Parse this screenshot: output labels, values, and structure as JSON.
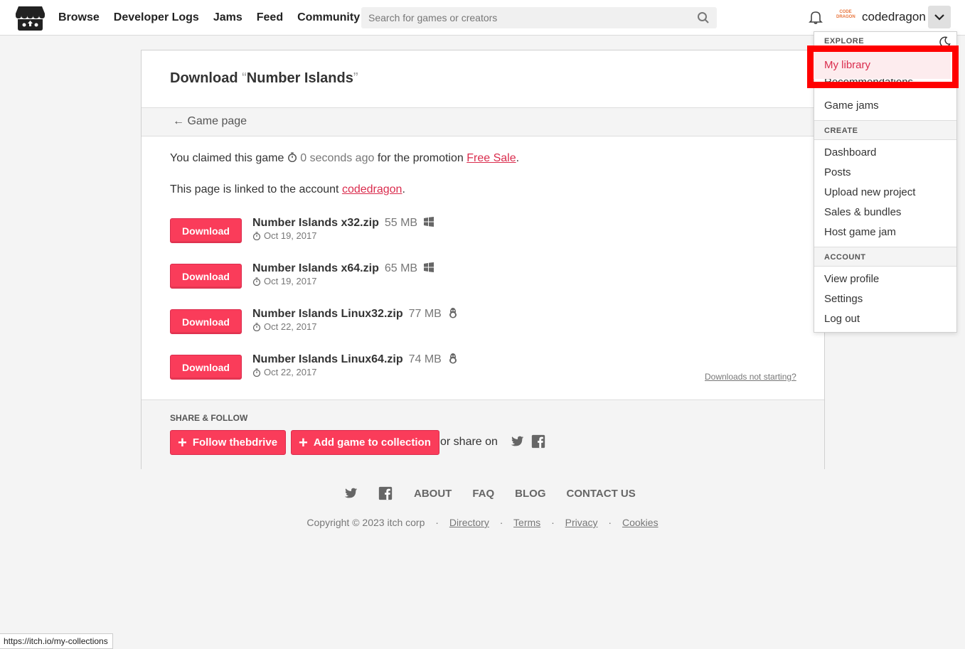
{
  "header": {
    "nav": [
      "Browse",
      "Developer Logs",
      "Jams",
      "Feed",
      "Community"
    ],
    "search_placeholder": "Search for games or creators",
    "username": "codedragon",
    "avatar_text": "CODE DRAGON"
  },
  "page": {
    "title_prefix": "Download ",
    "title_open_quote": "“",
    "title_game": "Number Islands",
    "title_close_quote": "”",
    "back_link": "← Game page",
    "claim_text_1": "You claimed this game",
    "claim_time": "0 seconds ago",
    "claim_text_2": "for the promotion",
    "promotion": "Free Sale",
    "linked_text": "This page is linked to the account",
    "linked_account": "codedragon",
    "download_label": "Download",
    "downloads_not_starting": "Downloads not starting?",
    "uploads": [
      {
        "name": "Number Islands x32.zip",
        "size": "55 MB",
        "platform": "windows-icon",
        "date": "Oct 19, 2017"
      },
      {
        "name": "Number Islands x64.zip",
        "size": "65 MB",
        "platform": "windows-icon",
        "date": "Oct 19, 2017"
      },
      {
        "name": "Number Islands Linux32.zip",
        "size": "77 MB",
        "platform": "linux-icon",
        "date": "Oct 22, 2017"
      },
      {
        "name": "Number Islands Linux64.zip",
        "size": "74 MB",
        "platform": "linux-icon",
        "date": "Oct 22, 2017"
      }
    ]
  },
  "share": {
    "title": "SHARE & FOLLOW",
    "follow_label": "Follow thebdrive",
    "collection_label": "Add game to collection",
    "share_on": "or share on"
  },
  "footer": {
    "links": [
      "ABOUT",
      "FAQ",
      "BLOG",
      "CONTACT US"
    ],
    "copyright": "Copyright © 2023 itch corp",
    "legal": [
      "Directory",
      "Terms",
      "Privacy",
      "Cookies"
    ],
    "separator": "·"
  },
  "dropdown": {
    "sections": [
      {
        "title": "EXPLORE",
        "items": [
          "My library",
          "Recommendations",
          "Game jams"
        ]
      },
      {
        "title": "CREATE",
        "items": [
          "Dashboard",
          "Posts",
          "Upload new project",
          "Sales & bundles",
          "Host game jam"
        ]
      },
      {
        "title": "ACCOUNT",
        "items": [
          "View profile",
          "Settings",
          "Log out"
        ]
      }
    ]
  },
  "status_bar": {
    "url": "https://itch.io/my-collections"
  },
  "colors": {
    "accent": "#fa3c5a",
    "link": "#da2c4d",
    "highlight_box": "#ff0000"
  }
}
